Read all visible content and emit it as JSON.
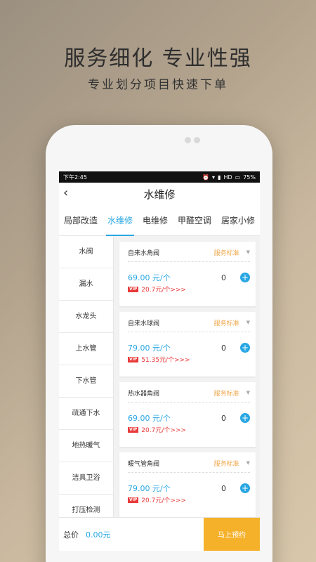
{
  "promo": {
    "headline": "服务细化 专业性强",
    "subline": "专业划分项目快速下单"
  },
  "statusbar": {
    "time": "下午2:45",
    "network": "HD",
    "battery": "75%"
  },
  "header": {
    "back_icon": "chevron-left-icon",
    "title": "水维修"
  },
  "tabs": [
    {
      "label": "局部改造"
    },
    {
      "label": "水维修"
    },
    {
      "label": "电维修"
    },
    {
      "label": "甲醛空调"
    },
    {
      "label": "居家小修"
    }
  ],
  "sidebar": {
    "items": [
      {
        "label": "水阀"
      },
      {
        "label": "漏水"
      },
      {
        "label": "水龙头"
      },
      {
        "label": "上水管"
      },
      {
        "label": "下水管"
      },
      {
        "label": "疏通下水"
      },
      {
        "label": "地热暖气"
      },
      {
        "label": "洁具卫浴"
      },
      {
        "label": "打压检测"
      }
    ]
  },
  "services": [
    {
      "name": "自来水角阀",
      "standard": "服务标准",
      "price": "69.00 元/个",
      "qty": "0",
      "vip_badge": "VIP",
      "vip_price": "20.7元/个>>>"
    },
    {
      "name": "自来水球阀",
      "standard": "服务标准",
      "price": "79.00 元/个",
      "qty": "0",
      "vip_badge": "VIP",
      "vip_price": "51.35元/个>>>"
    },
    {
      "name": "热水器角阀",
      "standard": "服务标准",
      "price": "69.00 元/个",
      "qty": "0",
      "vip_badge": "VIP",
      "vip_price": "20.7元/个>>>"
    },
    {
      "name": "暖气管角阀",
      "standard": "服务标准",
      "price": "79.00 元/个",
      "qty": "0",
      "vip_badge": "VIP",
      "vip_price": "20.7元/个>>>"
    }
  ],
  "footer": {
    "total_label": "总价",
    "total_value": "0.00元",
    "book_label": "马上预约"
  },
  "colors": {
    "accent": "#29a7e3",
    "standard": "#f0a84d",
    "vip": "#e83a3a",
    "book_button": "#f6b12a"
  }
}
